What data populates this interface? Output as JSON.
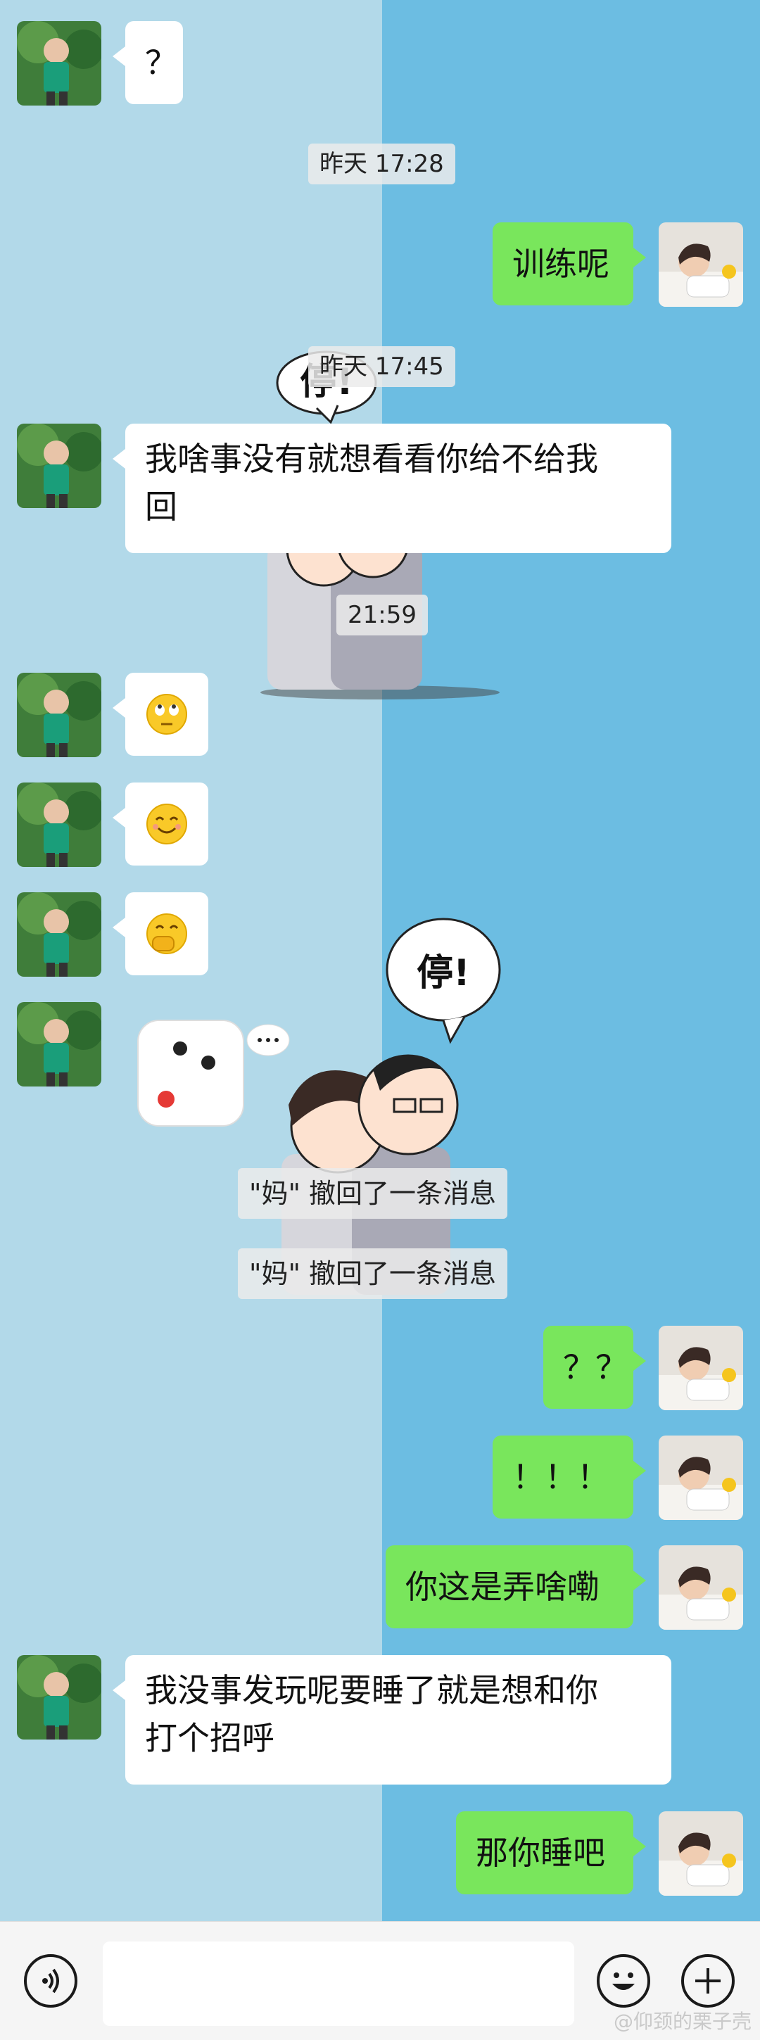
{
  "chat": {
    "messages": [
      {
        "side": "in",
        "text": "？"
      },
      {
        "type": "time",
        "text": "昨天 17:28"
      },
      {
        "side": "out",
        "text": "训练呢"
      },
      {
        "type": "time",
        "text": "昨天 17:45"
      },
      {
        "side": "in",
        "text": "我啥事没有就想看看你给不给我回"
      },
      {
        "type": "time",
        "text": "21:59"
      },
      {
        "side": "in",
        "emoji": "rolling-eyes-emoji"
      },
      {
        "side": "in",
        "emoji": "smile-emoji"
      },
      {
        "side": "in",
        "emoji": "hand-over-mouth-emoji"
      },
      {
        "side": "in",
        "sticker": "dice-sticker"
      },
      {
        "type": "system",
        "text": "\"妈\" 撤回了一条消息"
      },
      {
        "type": "system",
        "text": "\"妈\" 撤回了一条消息"
      },
      {
        "side": "out",
        "text": "？？"
      },
      {
        "side": "out",
        "text": "！！！"
      },
      {
        "side": "out",
        "text": "你这是弄啥嘞"
      },
      {
        "side": "in",
        "text": "我没事发玩呢要睡了就是想和你打个招呼"
      },
      {
        "side": "out",
        "text": "那你睡吧"
      }
    ]
  },
  "texts": {
    "m1": "？",
    "t1": "昨天 17:28",
    "m2": "训练呢",
    "t2": "昨天 17:45",
    "m3a": "我啥事没有就想看看你给不给我",
    "m3b": "回",
    "t3": "21:59",
    "sys1": "\"妈\" 撤回了一条消息",
    "sys2": "\"妈\" 撤回了一条消息",
    "m4": "？？",
    "m5": "！！！",
    "m6": "你这是弄啥嘞",
    "m7a": "我没事发玩呢要睡了就是想和你",
    "m7b": "打个招呼",
    "m8": "那你睡吧",
    "sticker_text_1": "停!",
    "sticker_text_2": "停!",
    "watermark": "@仰颈的栗子壳"
  },
  "colors": {
    "left_bg": "#b2d9e9",
    "right_bg": "#6cbde2",
    "incoming_bubble": "#ffffff",
    "outgoing_bubble": "#79e65c"
  },
  "input_bar": {
    "voice_icon": "voice-icon",
    "emoji_icon": "emoji-icon",
    "plus_icon": "plus-icon"
  }
}
